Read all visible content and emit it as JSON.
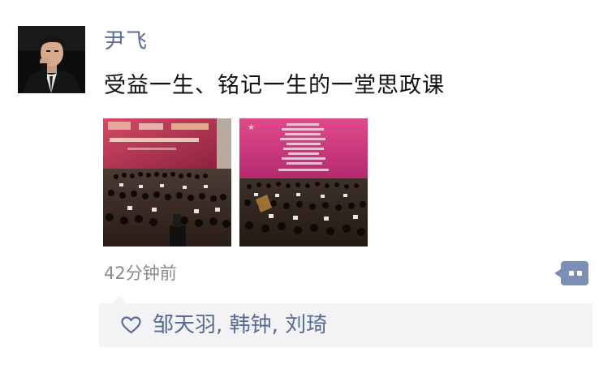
{
  "post": {
    "author": "尹飞",
    "text": "受益一生、铭记一生的一堂思政课",
    "time": "42分钟前",
    "images": [
      {
        "icon": "concert-photo"
      },
      {
        "icon": "concert-photo"
      }
    ]
  },
  "likes": {
    "icon": "heart-icon",
    "names": [
      "邹天羽",
      "韩钟",
      "刘琦"
    ],
    "separator": ", "
  },
  "colors": {
    "link": "#576b95",
    "text": "#111111",
    "time": "#8a8a8a",
    "panel": "#f3f3f5",
    "comment_button": "#7d8fb5"
  }
}
